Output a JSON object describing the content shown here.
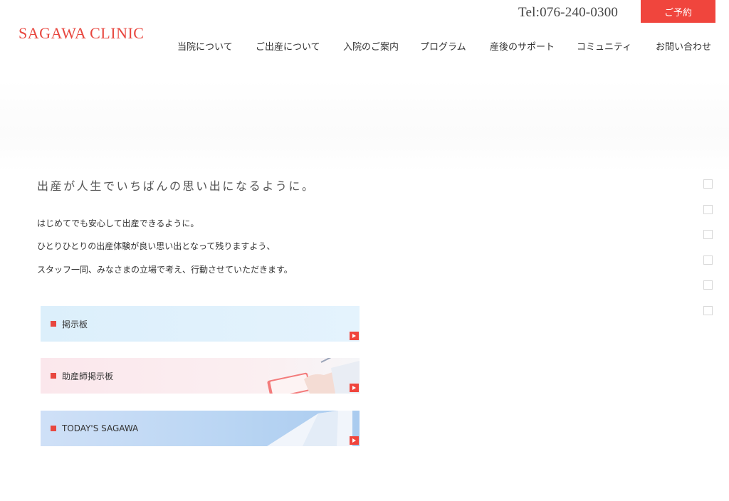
{
  "header": {
    "logo": "SAGAWA CLINIC",
    "tel": "Tel:076-240-0300",
    "reserve_label": "ご予約"
  },
  "nav": {
    "items": [
      {
        "label": "当院について"
      },
      {
        "label": "ご出産について"
      },
      {
        "label": "入院のご案内"
      },
      {
        "label": "プログラム"
      },
      {
        "label": "産後のサポート"
      },
      {
        "label": "コミュニティ"
      },
      {
        "label": "お問い合わせ"
      }
    ]
  },
  "main": {
    "headline": "出産が人生でいちばんの思い出になるように。",
    "paragraphs": [
      "はじめてでも安心して出産できるように。",
      "ひとりひとりの出産体験が良い思い出となって残りますよう、",
      "スタッフ一同、みなさまの立場で考え、行動させていただきます。"
    ],
    "banners": [
      {
        "label": "掲示板"
      },
      {
        "label": "助産師掲示板"
      },
      {
        "label": "TODAY'S SAGAWA"
      }
    ]
  },
  "colors": {
    "accent": "#e8473f",
    "button": "#f0453d"
  },
  "icons": {
    "banner_bullet": "square-bullet-icon",
    "banner_arrow": "play-arrow-icon",
    "slide_indicator": "square-dot-icon"
  }
}
